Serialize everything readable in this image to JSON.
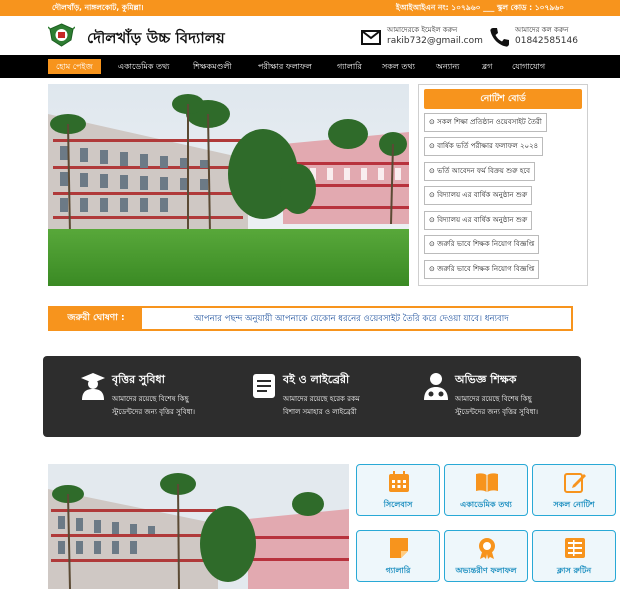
{
  "topbar": {
    "address": "দৌলখাঁড়, নাঙ্গলকোট, কুমিল্লা।",
    "codes": "ইআইআইএন নং: ১০৭৯৬০ ___ স্কুল কোড : ১০৭৯৬০"
  },
  "header": {
    "school_name": "দৌলখাঁড় উচ্চ বিদ্যালয়",
    "email_label": "আমাদেরকে ইমেইল করুন",
    "email": "rakib732@gmail.com",
    "phone_label": "আমাদের কল করুন",
    "phone": "01842585146"
  },
  "nav": {
    "items": [
      "হোম পেইজ",
      "একাডেমিক তথ্য",
      "শিক্ষকমণ্ডলী",
      "পরীক্ষার ফলাফল",
      "গ্যালারি",
      "সকল তথ্য",
      "অন্যান্য",
      "ব্লগ",
      "যোগাযোগ"
    ]
  },
  "notice": {
    "title": "নোটিশ বোর্ড",
    "items": [
      "সকল শিক্ষা প্রতিষ্ঠান ওয়েবসাইট তৈরী",
      "বার্ষিক ভর্তি পরীক্ষার ফলাফল ২০২৪",
      "ভর্তি আবেদন ফর্ম বিক্রয় শুরু হবে",
      "বিদ্যালয় এর বার্ষিক অনুষ্ঠান শুরু",
      "বিদ্যালয় এর বার্ষিক অনুষ্ঠান শুরু",
      "জরুরি ভাবে শিক্ষক নিয়োগ বিজ্ঞপ্তি",
      "জরুরি ভাবে শিক্ষক নিয়োগ বিজ্ঞপ্তি"
    ]
  },
  "announcement": {
    "label": "জরুরী ঘোষণা :",
    "text": "আপনার পছন্দ অনুযায়ী আপনাকে যেকোন ধরনের ওয়েবসাইট তৈরি করে দেওয়া যাবে। ধন্যবাদ"
  },
  "features": [
    {
      "icon": "graduate-icon",
      "title": "বৃত্তির সুবিধা",
      "line1": "আমাদের রয়েছে বিশেষ কিছু",
      "line2": "স্টুডেন্টদের জন্য বৃত্তির সুবিধা।"
    },
    {
      "icon": "book-icon",
      "title": "বই ও লাইব্রেরী",
      "line1": "আমাদের রয়েছে হরেক রকম",
      "line2": "বিশাল সমাহার ও লাইব্রেরী"
    },
    {
      "icon": "teacher-icon",
      "title": "অভিজ্ঞ শিক্ষক",
      "line1": "আমাদের রয়েছে বিশেষ কিছু",
      "line2": "স্টুডেন্টদের জন্য বৃত্তির সুবিধা।"
    }
  ],
  "quick_links": [
    {
      "label": "সিলেবাস",
      "icon": "calendar-icon"
    },
    {
      "label": "একাডেমিক তথ্য",
      "icon": "open-book-icon"
    },
    {
      "label": "সকল নোটিশ",
      "icon": "edit-icon"
    },
    {
      "label": "গ্যালারি",
      "icon": "note-icon"
    },
    {
      "label": "অভ্যন্তরীণ ফলাফল",
      "icon": "certificate-icon"
    },
    {
      "label": "ক্লাস রুটিন",
      "icon": "routine-icon"
    }
  ],
  "colors": {
    "accent": "#f7941d",
    "nav": "#000000",
    "feature_bg": "#2d2d2d",
    "link_blue": "#29a9d6"
  }
}
